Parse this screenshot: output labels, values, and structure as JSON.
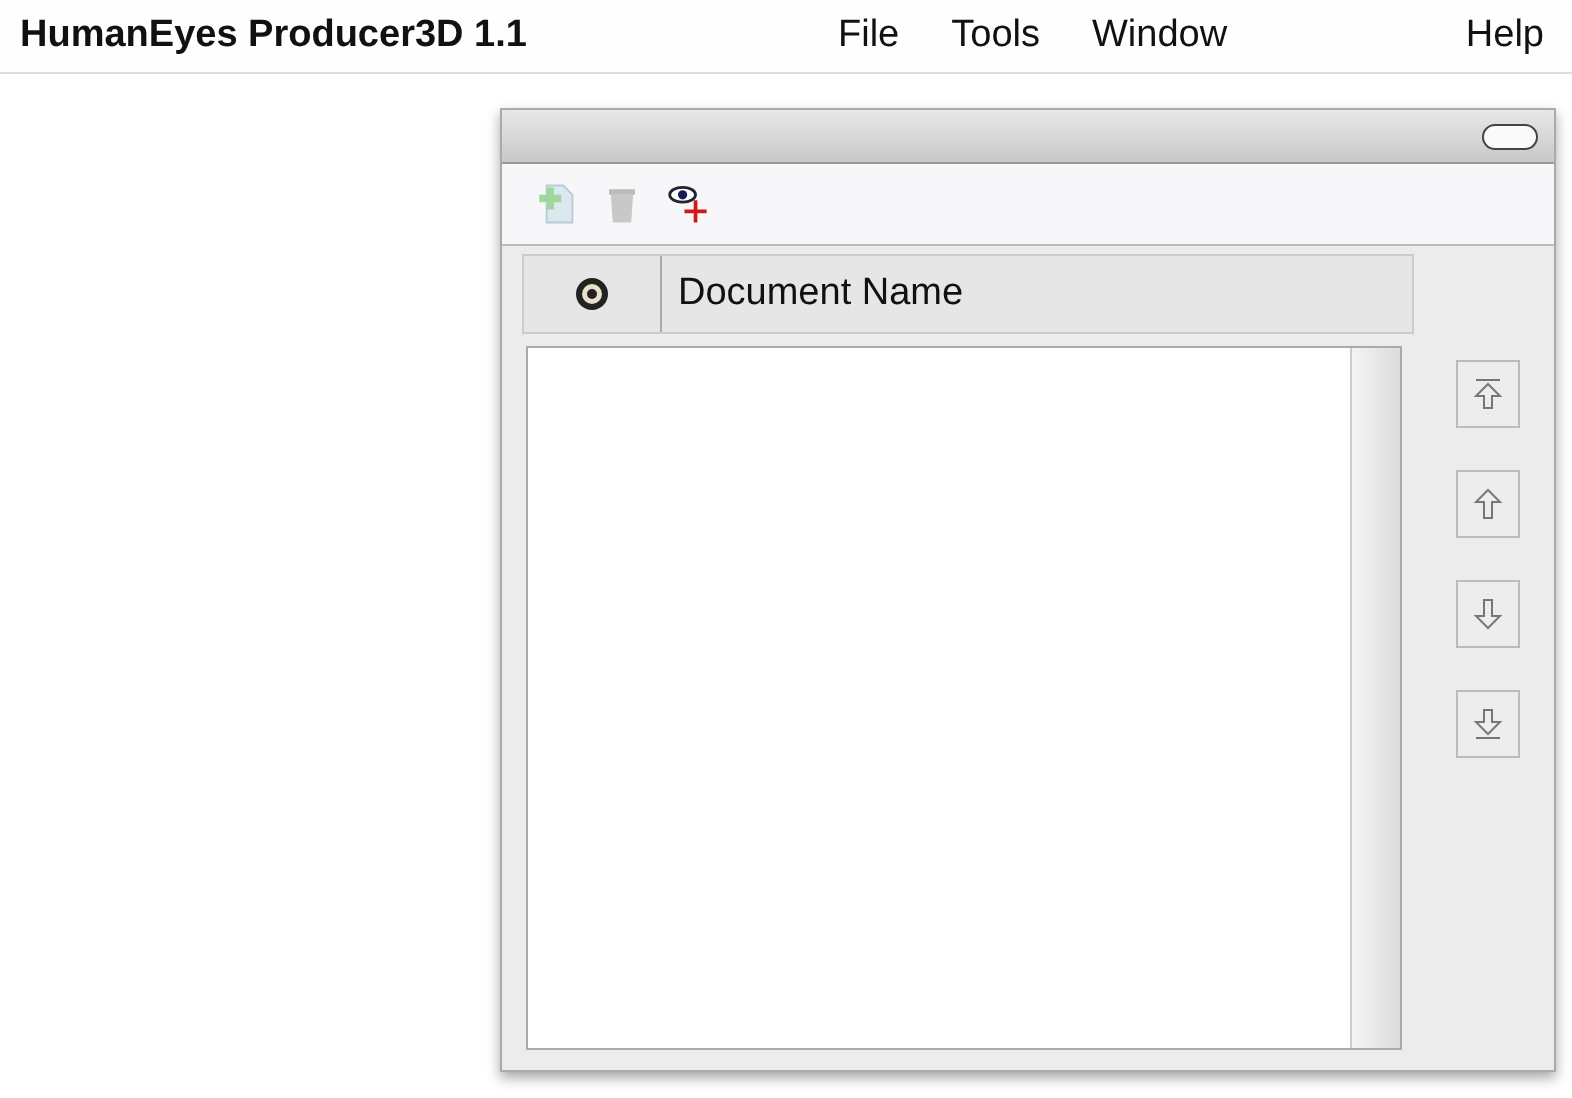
{
  "menu_bar": {
    "app_name": "HumanEyes Producer3D 1.1",
    "items": [
      "File",
      "Tools",
      "Window",
      "Help"
    ]
  },
  "document_table": {
    "columns": [
      "Document Name"
    ]
  }
}
